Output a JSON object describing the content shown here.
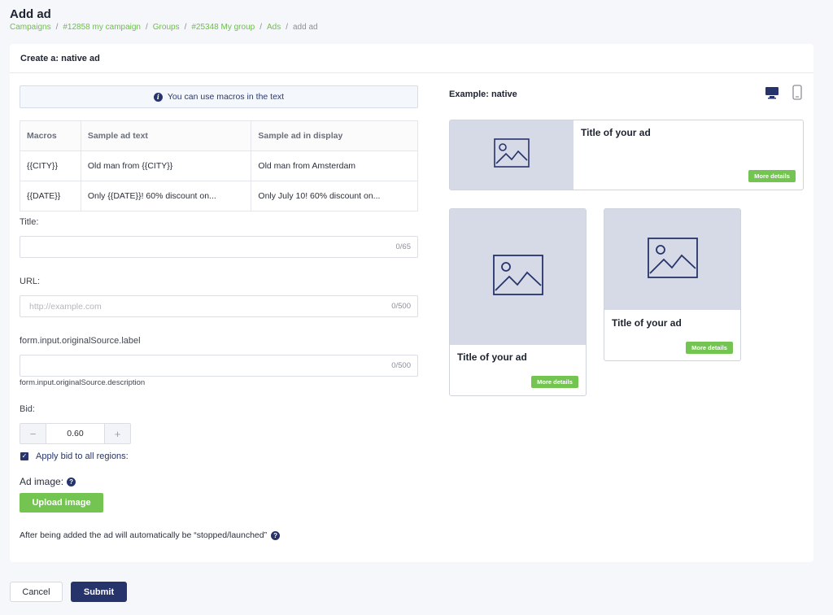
{
  "page": {
    "title": "Add ad"
  },
  "breadcrumb": [
    {
      "label": "Campaigns"
    },
    {
      "label": "#12858 my campaign"
    },
    {
      "label": "Groups"
    },
    {
      "label": "#25348 My group"
    },
    {
      "label": "Ads"
    },
    {
      "label": "add ad"
    }
  ],
  "form": {
    "header": "Create a: native ad",
    "info_text": "You can use macros in the text",
    "macros_table": {
      "headers": [
        "Macros",
        "Sample ad text",
        "Sample ad in display"
      ],
      "rows": [
        [
          "{{CITY}}",
          "Old man from {{CITY}}",
          "Old man from Amsterdam"
        ],
        [
          "{{DATE}}",
          "Only {{DATE}}! 60% discount on...",
          "Only July 10! 60% discount on..."
        ]
      ]
    },
    "title": {
      "label": "Title:",
      "value": "",
      "counter": "0/65"
    },
    "url": {
      "label": "URL:",
      "placeholder": "http://example.com",
      "counter": "0/500"
    },
    "original_source": {
      "label": "form.input.originalSource.label",
      "value": "",
      "counter": "0/500",
      "description": "form.input.originalSource.description"
    },
    "bid": {
      "label": "Bid:",
      "value": "0.60",
      "decrement": "−",
      "increment": "+"
    },
    "apply_bid": {
      "label": "Apply bid to all regions:",
      "checked": true
    },
    "ad_image": {
      "label": "Ad image:",
      "upload_label": "Upload image"
    },
    "after_note": "After being added the ad will automatically be “stopped/launched”"
  },
  "preview": {
    "title": "Example: native",
    "devices": [
      "desktop-icon",
      "mobile-icon"
    ],
    "ads": [
      {
        "title": "Title of your ad",
        "button": "More details"
      },
      {
        "title": "Title of your ad",
        "button": "More details"
      },
      {
        "title": "Title of your ad",
        "button": "More details"
      }
    ]
  },
  "actions": {
    "cancel": "Cancel",
    "submit": "Submit"
  },
  "colors": {
    "accent_green": "#74c452",
    "brand_navy": "#27346b",
    "image_placeholder": "#d6d9e6"
  }
}
